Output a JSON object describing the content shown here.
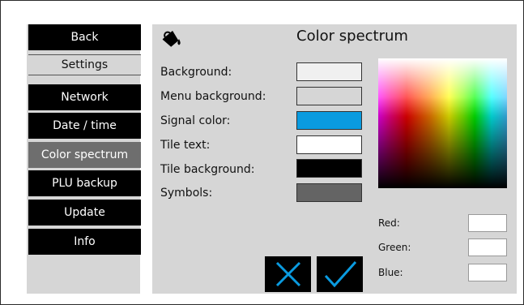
{
  "sidebar": {
    "back_label": "Back",
    "section_label": "Settings",
    "items": [
      {
        "label": "Network"
      },
      {
        "label": "Date / time"
      },
      {
        "label": "Color spectrum"
      },
      {
        "label": "PLU backup"
      },
      {
        "label": "Update"
      },
      {
        "label": "Info"
      }
    ],
    "active_item": "Color spectrum"
  },
  "main": {
    "title": "Color spectrum",
    "title_icon": "paint-bucket-icon",
    "color_settings": [
      {
        "label": "Background:",
        "color": "#f0f0f0"
      },
      {
        "label": "Menu background:",
        "color": "#d6d6d6"
      },
      {
        "label": "Signal color:",
        "color": "#0a9be0"
      },
      {
        "label": "Tile text:",
        "color": "#ffffff"
      },
      {
        "label": "Tile background:",
        "color": "#000000"
      },
      {
        "label": "Symbols:",
        "color": "#646464"
      }
    ],
    "rgb": {
      "red_label": "Red:",
      "green_label": "Green:",
      "blue_label": "Blue:",
      "red_value": "",
      "green_value": "",
      "blue_value": ""
    },
    "buttons": {
      "cancel_icon": "close-icon",
      "confirm_icon": "checkmark-icon",
      "accent_color": "#0a9be0"
    }
  }
}
